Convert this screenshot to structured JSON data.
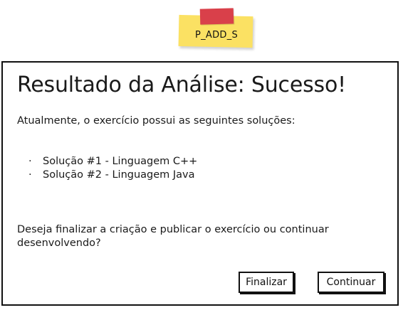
{
  "sticky_note": {
    "label": "P_ADD_S",
    "colors": {
      "note": "#fbe163",
      "tape": "#d9404a"
    }
  },
  "dialog": {
    "title": "Resultado da Análise: Sucesso!",
    "intro": "Atualmente, o exercício possui as seguintes soluções:",
    "bullet_glyph": "·",
    "solutions": [
      {
        "label": "Solução #1 - Linguagem C++"
      },
      {
        "label": "Solução #2 - Linguagem Java"
      }
    ],
    "question": "Deseja finalizar a criação e publicar o exercício ou continuar desenvolvendo?",
    "buttons": {
      "finish_label": "Finalizar",
      "continue_label": "Continuar"
    }
  }
}
